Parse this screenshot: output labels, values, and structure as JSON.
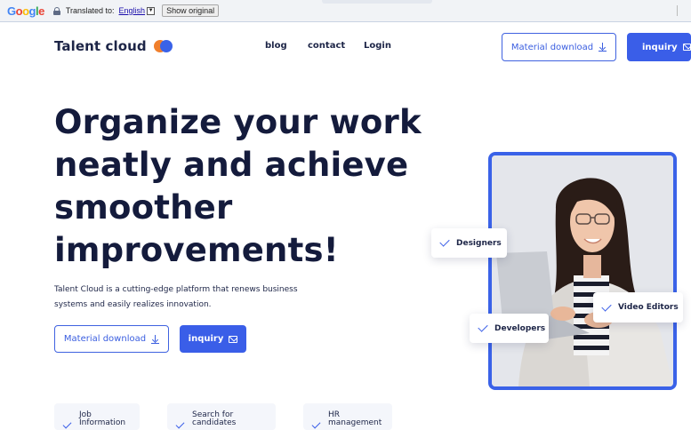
{
  "translate_bar": {
    "logo": "Google",
    "translated_to_label": "Translated to:",
    "language": "English",
    "show_original": "Show original"
  },
  "header": {
    "brand": "Talent cloud",
    "nav": [
      "blog",
      "contact",
      "Login"
    ],
    "material_download": "Material download",
    "inquiry": "inquiry"
  },
  "hero": {
    "title_lines": [
      "Organize your work",
      "neatly and achieve",
      "smoother",
      "improvements!"
    ],
    "description_lines": [
      "Talent Cloud is a cutting-edge platform that renews business",
      "systems and easily realizes innovation."
    ],
    "material_download": "Material download",
    "inquiry": "inquiry"
  },
  "photo_tags": {
    "designers": "Designers",
    "video_editors": "Video Editors",
    "developers": "Developers"
  },
  "feature_cards": [
    {
      "label_lines": [
        "Job",
        "Information"
      ]
    },
    {
      "label_lines": [
        "Search for",
        "candidates"
      ]
    },
    {
      "label_lines": [
        "HR",
        "management"
      ]
    }
  ],
  "colors": {
    "accent": "#3a5ee8",
    "text_dark": "#141b3c",
    "logo_orange": "#f07f2c",
    "card_bg": "#f4f6fb"
  },
  "icons": {
    "download": "download-icon",
    "mail": "mail-icon",
    "check": "check-icon",
    "lock": "lock-icon"
  }
}
